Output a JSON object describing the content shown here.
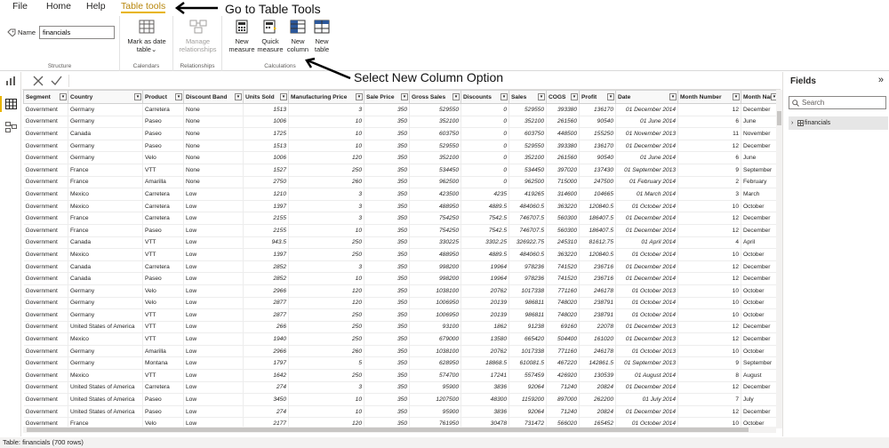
{
  "menubar": {
    "items": [
      {
        "label": "File",
        "active": false
      },
      {
        "label": "Home",
        "active": false
      },
      {
        "label": "Help",
        "active": false
      },
      {
        "label": "Table tools",
        "active": true
      }
    ]
  },
  "ribbon": {
    "name_label": "Name",
    "name_value": "financials",
    "groups": {
      "structure": "Structure",
      "calendars": "Calendars",
      "relationships": "Relationships",
      "calculations": "Calculations"
    },
    "buttons": {
      "mark_as_date_line1": "Mark as date",
      "mark_as_date_line2": "table",
      "manage_rel_line1": "Manage",
      "manage_rel_line2": "relationships",
      "new_measure_line1": "New",
      "new_measure_line2": "measure",
      "quick_measure_line1": "Quick",
      "quick_measure_line2": "measure",
      "new_column_line1": "New",
      "new_column_line2": "column",
      "new_table_line1": "New",
      "new_table_line2": "table"
    }
  },
  "annotations": {
    "go_to_table_tools": "Go to Table Tools",
    "select_new_column": "Select New Column Option"
  },
  "table": {
    "columns": [
      "Segment",
      "Country",
      "Product",
      "Discount Band",
      "Units Sold",
      "Manufacturing Price",
      "Sale Price",
      "Gross Sales",
      "Discounts",
      "Sales",
      "COGS",
      "Profit",
      "Date",
      "Month Number",
      "Month Name"
    ],
    "rows": [
      [
        "Government",
        "Germany",
        "Carretera",
        "None",
        "1513",
        "3",
        "350",
        "529550",
        "0",
        "529550",
        "393380",
        "136170",
        "01 December 2014",
        "12",
        "December"
      ],
      [
        "Government",
        "Germany",
        "Paseo",
        "None",
        "1006",
        "10",
        "350",
        "352100",
        "0",
        "352100",
        "261560",
        "90540",
        "01 June 2014",
        "6",
        "June"
      ],
      [
        "Government",
        "Canada",
        "Paseo",
        "None",
        "1725",
        "10",
        "350",
        "603750",
        "0",
        "603750",
        "448500",
        "155250",
        "01 November 2013",
        "11",
        "November"
      ],
      [
        "Government",
        "Germany",
        "Paseo",
        "None",
        "1513",
        "10",
        "350",
        "529550",
        "0",
        "529550",
        "393380",
        "136170",
        "01 December 2014",
        "12",
        "December"
      ],
      [
        "Government",
        "Germany",
        "Velo",
        "None",
        "1006",
        "120",
        "350",
        "352100",
        "0",
        "352100",
        "261560",
        "90540",
        "01 June 2014",
        "6",
        "June"
      ],
      [
        "Government",
        "France",
        "VTT",
        "None",
        "1527",
        "250",
        "350",
        "534450",
        "0",
        "534450",
        "397020",
        "137430",
        "01 September 2013",
        "9",
        "September"
      ],
      [
        "Government",
        "France",
        "Amarilla",
        "None",
        "2750",
        "260",
        "350",
        "962500",
        "0",
        "962500",
        "715000",
        "247500",
        "01 February 2014",
        "2",
        "February"
      ],
      [
        "Government",
        "Mexico",
        "Carretera",
        "Low",
        "1210",
        "3",
        "350",
        "423500",
        "4235",
        "419265",
        "314600",
        "104665",
        "01 March 2014",
        "3",
        "March"
      ],
      [
        "Government",
        "Mexico",
        "Carretera",
        "Low",
        "1397",
        "3",
        "350",
        "488950",
        "4889.5",
        "484060.5",
        "363220",
        "120840.5",
        "01 October 2014",
        "10",
        "October"
      ],
      [
        "Government",
        "France",
        "Carretera",
        "Low",
        "2155",
        "3",
        "350",
        "754250",
        "7542.5",
        "746707.5",
        "560300",
        "186407.5",
        "01 December 2014",
        "12",
        "December"
      ],
      [
        "Government",
        "France",
        "Paseo",
        "Low",
        "2155",
        "10",
        "350",
        "754250",
        "7542.5",
        "746707.5",
        "560300",
        "186407.5",
        "01 December 2014",
        "12",
        "December"
      ],
      [
        "Government",
        "Canada",
        "VTT",
        "Low",
        "943.5",
        "250",
        "350",
        "330225",
        "3302.25",
        "326922.75",
        "245310",
        "81612.75",
        "01 April 2014",
        "4",
        "April"
      ],
      [
        "Government",
        "Mexico",
        "VTT",
        "Low",
        "1397",
        "250",
        "350",
        "488950",
        "4889.5",
        "484060.5",
        "363220",
        "120840.5",
        "01 October 2014",
        "10",
        "October"
      ],
      [
        "Government",
        "Canada",
        "Carretera",
        "Low",
        "2852",
        "3",
        "350",
        "998200",
        "19964",
        "978236",
        "741520",
        "236716",
        "01 December 2014",
        "12",
        "December"
      ],
      [
        "Government",
        "Canada",
        "Paseo",
        "Low",
        "2852",
        "10",
        "350",
        "998200",
        "19964",
        "978236",
        "741520",
        "236716",
        "01 December 2014",
        "12",
        "December"
      ],
      [
        "Government",
        "Germany",
        "Velo",
        "Low",
        "2966",
        "120",
        "350",
        "1038100",
        "20762",
        "1017338",
        "771160",
        "246178",
        "01 October 2013",
        "10",
        "October"
      ],
      [
        "Government",
        "Germany",
        "Velo",
        "Low",
        "2877",
        "120",
        "350",
        "1006950",
        "20139",
        "986811",
        "748020",
        "238791",
        "01 October 2014",
        "10",
        "October"
      ],
      [
        "Government",
        "Germany",
        "VTT",
        "Low",
        "2877",
        "250",
        "350",
        "1006950",
        "20139",
        "986811",
        "748020",
        "238791",
        "01 October 2014",
        "10",
        "October"
      ],
      [
        "Government",
        "United States of America",
        "VTT",
        "Low",
        "266",
        "250",
        "350",
        "93100",
        "1862",
        "91238",
        "69160",
        "22078",
        "01 December 2013",
        "12",
        "December"
      ],
      [
        "Government",
        "Mexico",
        "VTT",
        "Low",
        "1940",
        "250",
        "350",
        "679000",
        "13580",
        "665420",
        "504400",
        "161020",
        "01 December 2013",
        "12",
        "December"
      ],
      [
        "Government",
        "Germany",
        "Amarilla",
        "Low",
        "2966",
        "260",
        "350",
        "1038100",
        "20762",
        "1017338",
        "771160",
        "246178",
        "01 October 2013",
        "10",
        "October"
      ],
      [
        "Government",
        "Germany",
        "Montana",
        "Low",
        "1797",
        "5",
        "350",
        "628950",
        "18868.5",
        "610081.5",
        "467220",
        "142861.5",
        "01 September 2013",
        "9",
        "September"
      ],
      [
        "Government",
        "Mexico",
        "VTT",
        "Low",
        "1642",
        "250",
        "350",
        "574700",
        "17241",
        "557459",
        "426920",
        "130539",
        "01 August 2014",
        "8",
        "August"
      ],
      [
        "Government",
        "United States of America",
        "Carretera",
        "Low",
        "274",
        "3",
        "350",
        "95900",
        "3836",
        "92064",
        "71240",
        "20824",
        "01 December 2014",
        "12",
        "December"
      ],
      [
        "Government",
        "United States of America",
        "Paseo",
        "Low",
        "3450",
        "10",
        "350",
        "1207500",
        "48300",
        "1159200",
        "897000",
        "262200",
        "01 July 2014",
        "7",
        "July"
      ],
      [
        "Government",
        "United States of America",
        "Paseo",
        "Low",
        "274",
        "10",
        "350",
        "95900",
        "3836",
        "92064",
        "71240",
        "20824",
        "01 December 2014",
        "12",
        "December"
      ],
      [
        "Government",
        "France",
        "Velo",
        "Low",
        "2177",
        "120",
        "350",
        "761950",
        "30478",
        "731472",
        "566020",
        "165452",
        "01 October 2014",
        "10",
        "October"
      ]
    ]
  },
  "fields_pane": {
    "title": "Fields",
    "search_placeholder": "Search",
    "items": [
      "financials"
    ]
  },
  "status": {
    "text": "Table: financials (700 rows)"
  }
}
